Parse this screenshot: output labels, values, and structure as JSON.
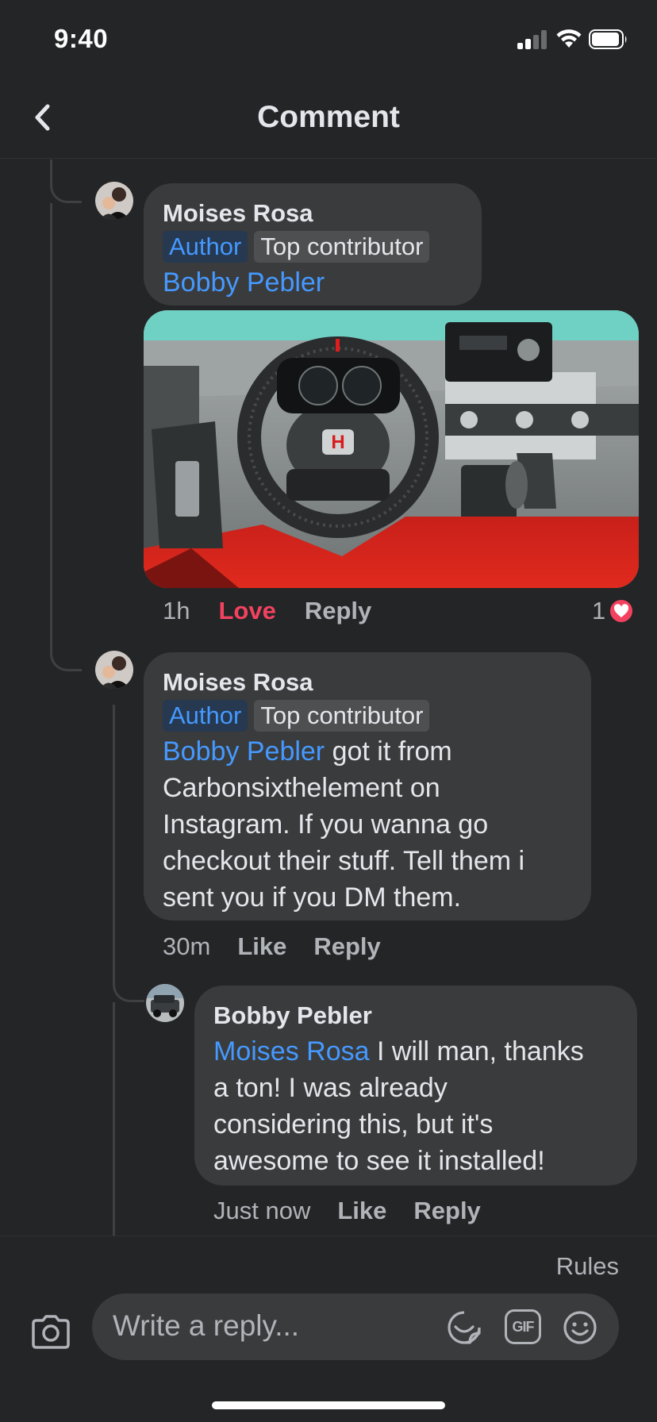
{
  "status_bar": {
    "time": "9:40"
  },
  "header": {
    "title": "Comment"
  },
  "comments": [
    {
      "author": "Moises Rosa",
      "badges": [
        "Author",
        "Top contributor"
      ],
      "mention": "Bobby Pebler",
      "text": "",
      "time": "1h",
      "reaction_action": "Love",
      "reply": "Reply",
      "reaction_count": "1",
      "reaction_color": "#f3425f"
    },
    {
      "author": "Moises Rosa",
      "badges": [
        "Author",
        "Top contributor"
      ],
      "mention": "Bobby Pebler",
      "text_lines": [
        " got it from",
        "Carbonsixthelement on",
        "Instagram. If you wanna go",
        "checkout their stuff. Tell them i",
        "sent you if you DM them."
      ],
      "time": "30m",
      "reaction_action": "Like",
      "reply": "Reply"
    },
    {
      "author": "Bobby Pebler",
      "mention": "Moises Rosa",
      "text_lines": [
        " I will man, thanks",
        "a ton! I was already",
        "considering this, but it's",
        "awesome to see it installed!"
      ],
      "time": "Just now",
      "reaction_action": "Like",
      "reply": "Reply"
    }
  ],
  "composer": {
    "rules": "Rules",
    "placeholder": "Write a reply...",
    "gif_label": "GIF"
  },
  "colors": {
    "background": "#242526",
    "bubble": "#3a3b3c",
    "mention": "#4599ff",
    "love": "#f3425f"
  }
}
